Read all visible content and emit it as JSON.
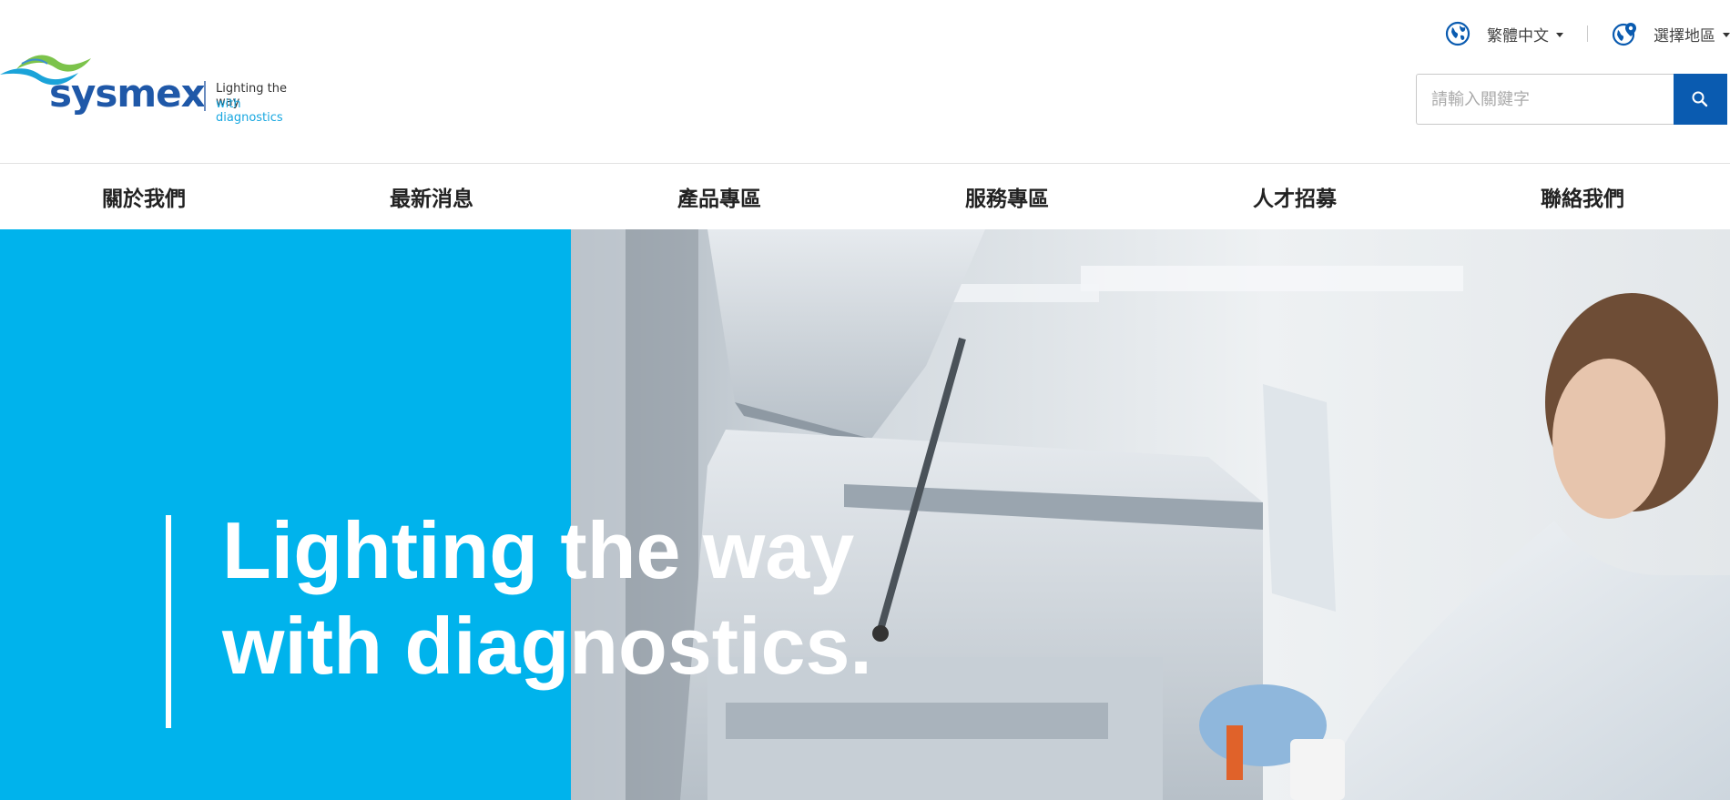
{
  "header": {
    "logo_text": "sysmex",
    "logo_tagline_1": "Lighting the way",
    "logo_tagline_2": "with diagnostics",
    "language_label": "繁體中文",
    "region_label": "選擇地區",
    "search_placeholder": "請輸入關鍵字"
  },
  "nav": {
    "items": [
      "關於我們",
      "最新消息",
      "產品專區",
      "服務專區",
      "人才招募",
      "聯絡我們"
    ]
  },
  "hero": {
    "title_line_1": "Lighting the way",
    "title_line_2": "with diagnostics."
  },
  "colors": {
    "brand_blue": "#1f58a8",
    "hero_blue": "#00b3ec",
    "search_button": "#0a5bb0"
  },
  "icons": {
    "language": "globe-icon",
    "region": "globe-pin-icon",
    "search": "search-icon",
    "dropdown": "caret-down-icon"
  }
}
